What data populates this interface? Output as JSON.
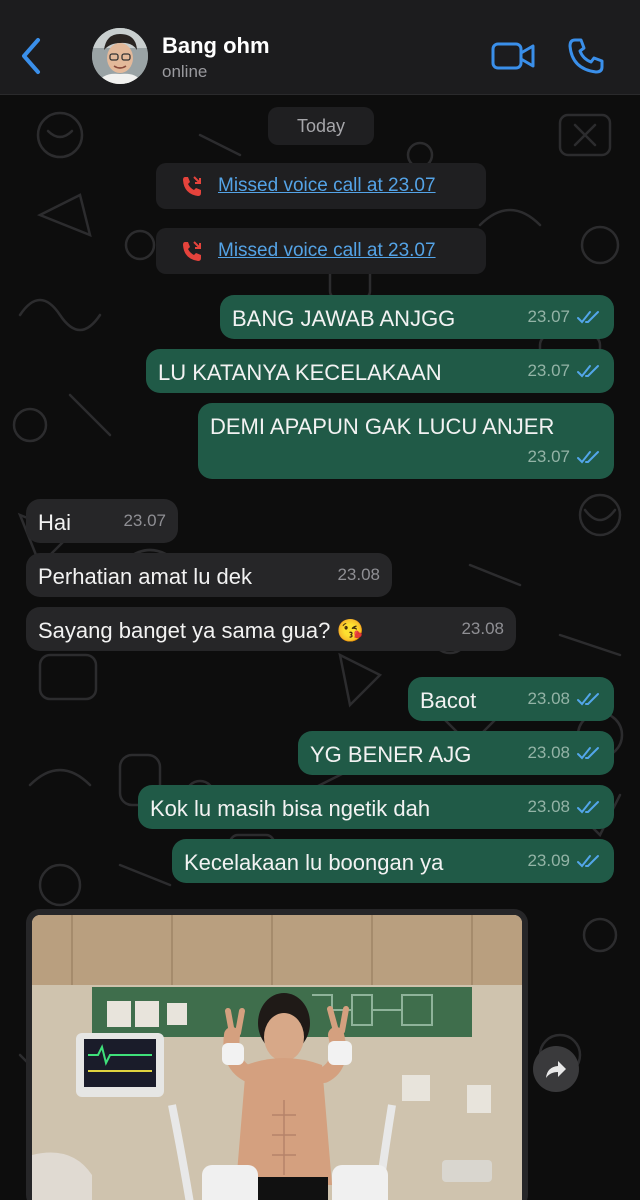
{
  "header": {
    "back_icon": "chevron-left-icon",
    "contact_name": "Bang ohm",
    "status": "online",
    "video_icon": "video-camera-icon",
    "phone_icon": "phone-icon",
    "accent_color": "#3a8fea"
  },
  "chat": {
    "date_label": "Today",
    "missed_calls": [
      {
        "label": "Missed voice call at 23.07",
        "icon": "missed-call-icon"
      },
      {
        "label": "Missed voice call at 23.07",
        "icon": "missed-call-icon"
      }
    ],
    "messages": [
      {
        "dir": "out",
        "text": "BANG JAWAB ANJGG",
        "time": "23.07",
        "status": "read"
      },
      {
        "dir": "out",
        "text": "LU KATANYA KECELAKAAN",
        "time": "23.07",
        "status": "read"
      },
      {
        "dir": "out",
        "text": "DEMI APAPUN GAK LUCU ANJER",
        "time": "23.07",
        "status": "read"
      },
      {
        "dir": "in",
        "text": "Hai",
        "time": "23.07"
      },
      {
        "dir": "in",
        "text": "Perhatian amat lu dek",
        "time": "23.08"
      },
      {
        "dir": "in",
        "text": "Sayang banget ya sama gua? 😘",
        "time": "23.08"
      },
      {
        "dir": "out",
        "text": "Bacot",
        "time": "23.08",
        "status": "read"
      },
      {
        "dir": "out",
        "text": "YG BENER AJG",
        "time": "23.08",
        "status": "read"
      },
      {
        "dir": "out",
        "text": "Kok lu masih bisa ngetik dah",
        "time": "23.08",
        "status": "read"
      },
      {
        "dir": "out",
        "text": "Kecelakaan lu boongan ya",
        "time": "23.09",
        "status": "read"
      }
    ],
    "photo_message": {
      "dir": "in",
      "forward_icon": "forward-arrow-icon"
    },
    "colors": {
      "outgoing_bubble": "#205a47",
      "incoming_bubble": "#262628",
      "read_tick": "#53a6ea",
      "missed_call_red": "#e5433c"
    }
  }
}
